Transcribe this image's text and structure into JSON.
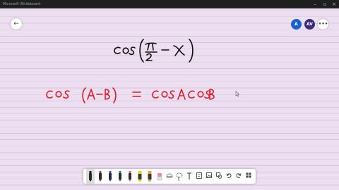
{
  "app": {
    "title": "Microsoft Whiteboard"
  },
  "header": {
    "back_glyph": "←",
    "avatar_share": "A",
    "avatar_user": "AV",
    "menu_glyph": "•••"
  },
  "board": {
    "line1": "cos (π/2 − x)",
    "line2": "cos (A−B) = cos A cos B"
  },
  "colors": {
    "board_bg": "#ecdff0",
    "ruling": "#d6c6e0",
    "ink_black": "#111111",
    "ink_red": "#e01a2a",
    "share_blue": "#1b5fd6",
    "avatar_purple": "#3b2a7e"
  },
  "toolbar": {
    "tools": [
      {
        "name": "pen-black",
        "icon": "pen-icon",
        "color": "#111111",
        "selected": true
      },
      {
        "name": "pen-red",
        "icon": "pen-icon",
        "color": "#e01a2a",
        "selected": false
      },
      {
        "name": "pen-blue",
        "icon": "pen-icon",
        "color": "#1f4ed8",
        "selected": false
      },
      {
        "name": "pen-green",
        "icon": "pen-icon",
        "color": "#1d8a3a",
        "selected": false
      },
      {
        "name": "pen-pink",
        "icon": "pen-icon",
        "color": "#d64fb3",
        "selected": false
      },
      {
        "name": "highlighter-yellow",
        "icon": "highlighter-icon",
        "color": "#f2d200",
        "selected": false
      },
      {
        "name": "highlighter-orange",
        "icon": "highlighter-icon",
        "color": "#f0a030",
        "selected": false
      },
      {
        "name": "eraser",
        "icon": "eraser-icon",
        "color": "#f08aa8",
        "selected": false
      },
      {
        "name": "ruler",
        "icon": "ruler-icon",
        "color": "#777777",
        "selected": false
      },
      {
        "name": "lasso",
        "icon": "lasso-icon",
        "color": "#555555",
        "selected": false
      },
      {
        "name": "text",
        "icon": "text-icon",
        "color": "#333333",
        "selected": false
      },
      {
        "name": "note",
        "icon": "note-icon",
        "color": "#444444",
        "selected": false
      },
      {
        "name": "image",
        "icon": "image-icon",
        "color": "#444444",
        "selected": false
      },
      {
        "name": "shapes",
        "icon": "shapes-icon",
        "color": "#444444",
        "selected": false
      },
      {
        "name": "undo",
        "icon": "undo-icon",
        "color": "#333333",
        "selected": false
      },
      {
        "name": "redo",
        "icon": "redo-icon",
        "color": "#333333",
        "selected": false
      },
      {
        "name": "more-tools",
        "icon": "grid-icon",
        "color": "#444444",
        "selected": false
      }
    ]
  }
}
